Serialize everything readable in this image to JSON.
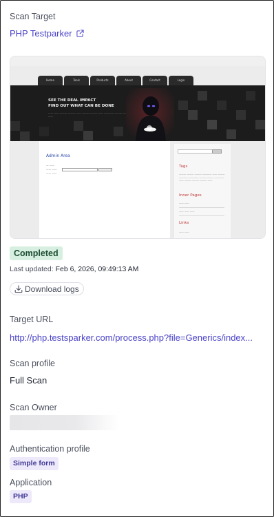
{
  "scan_target": {
    "label": "Scan Target",
    "name": "PHP Testparker",
    "icon": "external-link-icon"
  },
  "preview": {
    "nav_tabs": [
      "Home",
      "Tools",
      "Products",
      "About",
      "Contact",
      "Login"
    ],
    "headline_line1": "SEE THE REAL IMPACT",
    "headline_line2": "FIND OUT WHAT CAN BE DONE",
    "admin_area": "Admin Area",
    "side_tags": "Tags",
    "side_inner_pages": "Inner Pages",
    "side_links": "Links"
  },
  "status": {
    "badge": "Completed",
    "last_updated_label": "Last updated:",
    "last_updated_value": "Feb 6, 2026, 09:49:13 AM",
    "badge_color": "#d7efe0"
  },
  "download": {
    "label": "Download logs",
    "icon": "download-icon"
  },
  "target_url": {
    "label": "Target URL",
    "value": "http://php.testsparker.com/process.php?file=Generics/index..."
  },
  "scan_profile": {
    "label": "Scan profile",
    "value": "Full Scan"
  },
  "scan_owner": {
    "label": "Scan Owner"
  },
  "auth_profile": {
    "label": "Authentication profile",
    "value": "Simple form"
  },
  "application": {
    "label": "Application",
    "value": "PHP"
  },
  "colors": {
    "link": "#4a42c8",
    "tag_bg": "#ede9fb",
    "tag_text": "#3e3693"
  }
}
